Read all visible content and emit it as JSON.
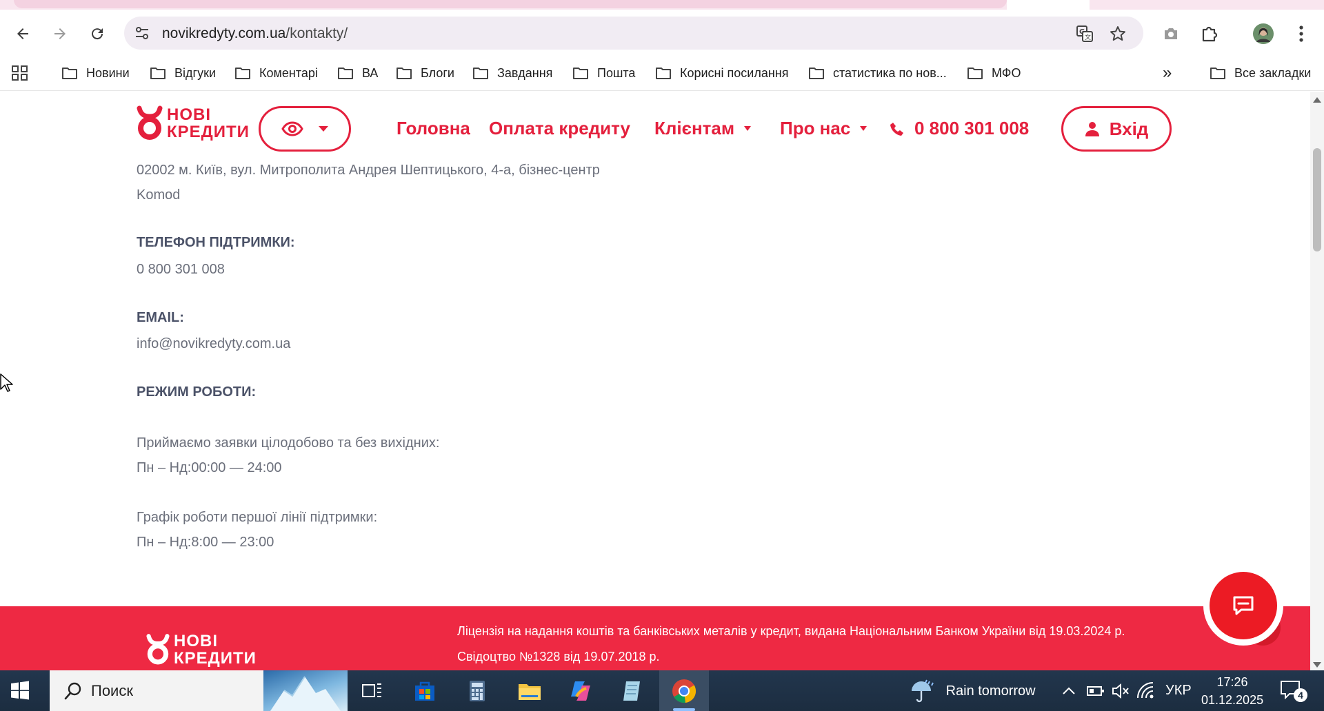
{
  "browser": {
    "url_host": "novikredyty.com.ua",
    "url_path": "/kontakty/",
    "bookmarks": [
      {
        "label": "Новини"
      },
      {
        "label": "Відгуки"
      },
      {
        "label": "Коментарі"
      },
      {
        "label": "ВА"
      },
      {
        "label": "Блоги"
      },
      {
        "label": "Завдання"
      },
      {
        "label": "Пошта"
      },
      {
        "label": "Корисні посилання"
      },
      {
        "label": "статистика по нов..."
      },
      {
        "label": "МФО"
      }
    ],
    "more_bookmarks": "»",
    "all_bookmarks": "Все закладки"
  },
  "site": {
    "logo_line1": "НОВІ",
    "logo_line2": "КРЕДИТИ",
    "nav": {
      "home": "Головна",
      "pay": "Оплата кредиту",
      "clients": "Клієнтам",
      "about": "Про нас",
      "phone": "0 800 301 008",
      "login": "Вхід"
    }
  },
  "contacts": {
    "address_line1": "02002 м. Київ, вул. Митрополита Андрея Шептицького, 4-а, бізнес-центр",
    "address_line2": "Komod",
    "phone_label": "ТЕЛЕФОН ПІДТРИМКИ:",
    "phone_value": "0 800 301 008",
    "email_label": "EMAIL:",
    "email_value": "info@novikredyty.com.ua",
    "hours_label": "РЕЖИМ РОБОТИ:",
    "hours_line1": "Приймаємо заявки цілодобово та без вихідних:",
    "hours_line2": "Пн – Нд:00:00 — 24:00",
    "hours_line3": "Графік роботи першої лінії підтримки:",
    "hours_line4": "Пн – Нд:8:00 — 23:00"
  },
  "footer": {
    "logo_line1": "НОВІ",
    "logo_line2": "КРЕДИТИ",
    "license": "Ліцензія на надання коштів та банківських металів у кредит, видана Національним Банком України від 19.03.2024 р.",
    "certificate": "Свідоцтво №1328 від 19.07.2018 р."
  },
  "taskbar": {
    "search_placeholder": "Поиск",
    "weather": "Rain tomorrow",
    "language": "УКР",
    "time": "17:26",
    "date": "01.12.2025",
    "notifications": "4"
  },
  "colors": {
    "brand_red": "#e4203d",
    "footer_red": "#ee2943",
    "chat_red": "#ec1b24"
  }
}
